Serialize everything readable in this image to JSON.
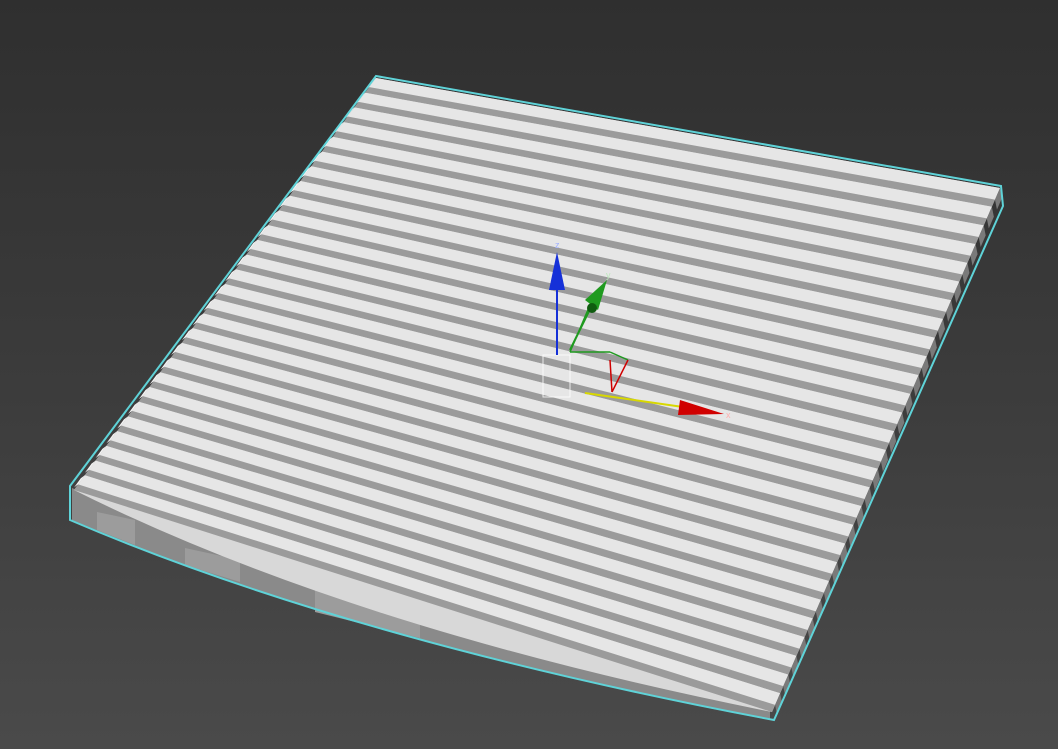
{
  "viewport": {
    "view": "perspective",
    "background_top": "#2f2f2f",
    "background_bottom": "#4a4a4a"
  },
  "scene_object": {
    "name": "slatted-panel",
    "slat_count": 28,
    "selected": true,
    "selection_color": "#5fd3d8",
    "face_color": "#e6e6e6",
    "side_color": "#7a7a7a",
    "groove_color": "#9b9b9b"
  },
  "gizmo": {
    "type": "move-transform",
    "axes": [
      {
        "axis": "x",
        "color": "#d00000",
        "label": "x"
      },
      {
        "axis": "y",
        "color": "#1f9a1f",
        "label": "y"
      },
      {
        "axis": "z",
        "color": "#1530d8",
        "label": "z"
      }
    ],
    "plane_color": "#ffff00"
  }
}
